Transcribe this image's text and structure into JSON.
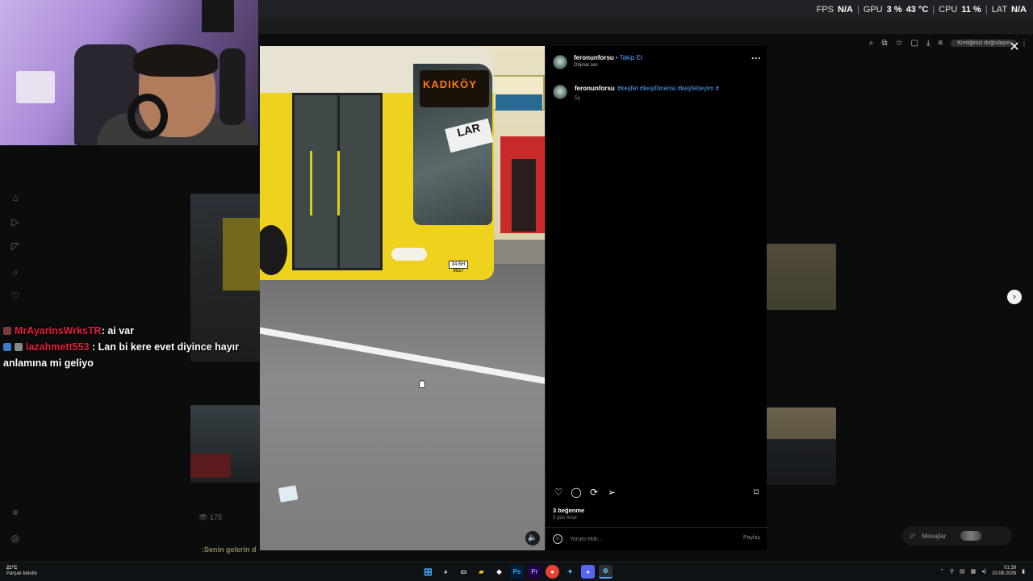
{
  "overlay": {
    "fps_label": "FPS",
    "fps_value": "N/A",
    "gpu_label": "GPU",
    "gpu_usage": "3 %",
    "gpu_temp": "43 °C",
    "cpu_label": "CPU",
    "cpu_usage": "11 %",
    "lat_label": "LAT",
    "lat_value": "N/A"
  },
  "browser": {
    "profile_pill": "Kimliğinizi doğrulayın"
  },
  "chat": {
    "messages": [
      {
        "user": "MrAyarInsWrksTR",
        "text": ": ai var"
      },
      {
        "user": "lazahmett553",
        "text": ": Lan bi kere evet diyince hayır anlamına mi geliyo"
      }
    ]
  },
  "background_feed": {
    "views": "175",
    "caption": ":Senin gelerin d"
  },
  "video": {
    "destination_sign": "KADIKÖY",
    "side_sign": "LAR",
    "plate": "34 BH 9557"
  },
  "post": {
    "username": "feronunforsu",
    "follow_label": "Takip Et",
    "audio": "Orijinal ses",
    "caption_user": "feronunforsu",
    "caption_tags": "#keşfet #keşifönerisi #keşfetteyim #",
    "caption_time": "5g",
    "likes": "3 beğenme",
    "posted_ago": "5 gün önce",
    "comment_placeholder": "Yorum ekle...",
    "share_label": "Paylaş"
  },
  "messages_pill": {
    "label": "Mesajlar"
  },
  "taskbar": {
    "weather_temp": "21°C",
    "weather_desc": "Parçalı bulutlu",
    "time": "01:39",
    "date": "10.08.2026"
  },
  "icons": {
    "close": "close-icon",
    "next": "chevron-right-icon",
    "like": "heart-icon",
    "comment": "comment-icon",
    "repost": "repost-icon",
    "share": "send-icon",
    "save": "bookmark-icon",
    "more": "more-icon"
  },
  "colors": {
    "accent": "#5aa2ff",
    "chat_user": "#e0203c",
    "bus_yellow": "#efd21e"
  }
}
